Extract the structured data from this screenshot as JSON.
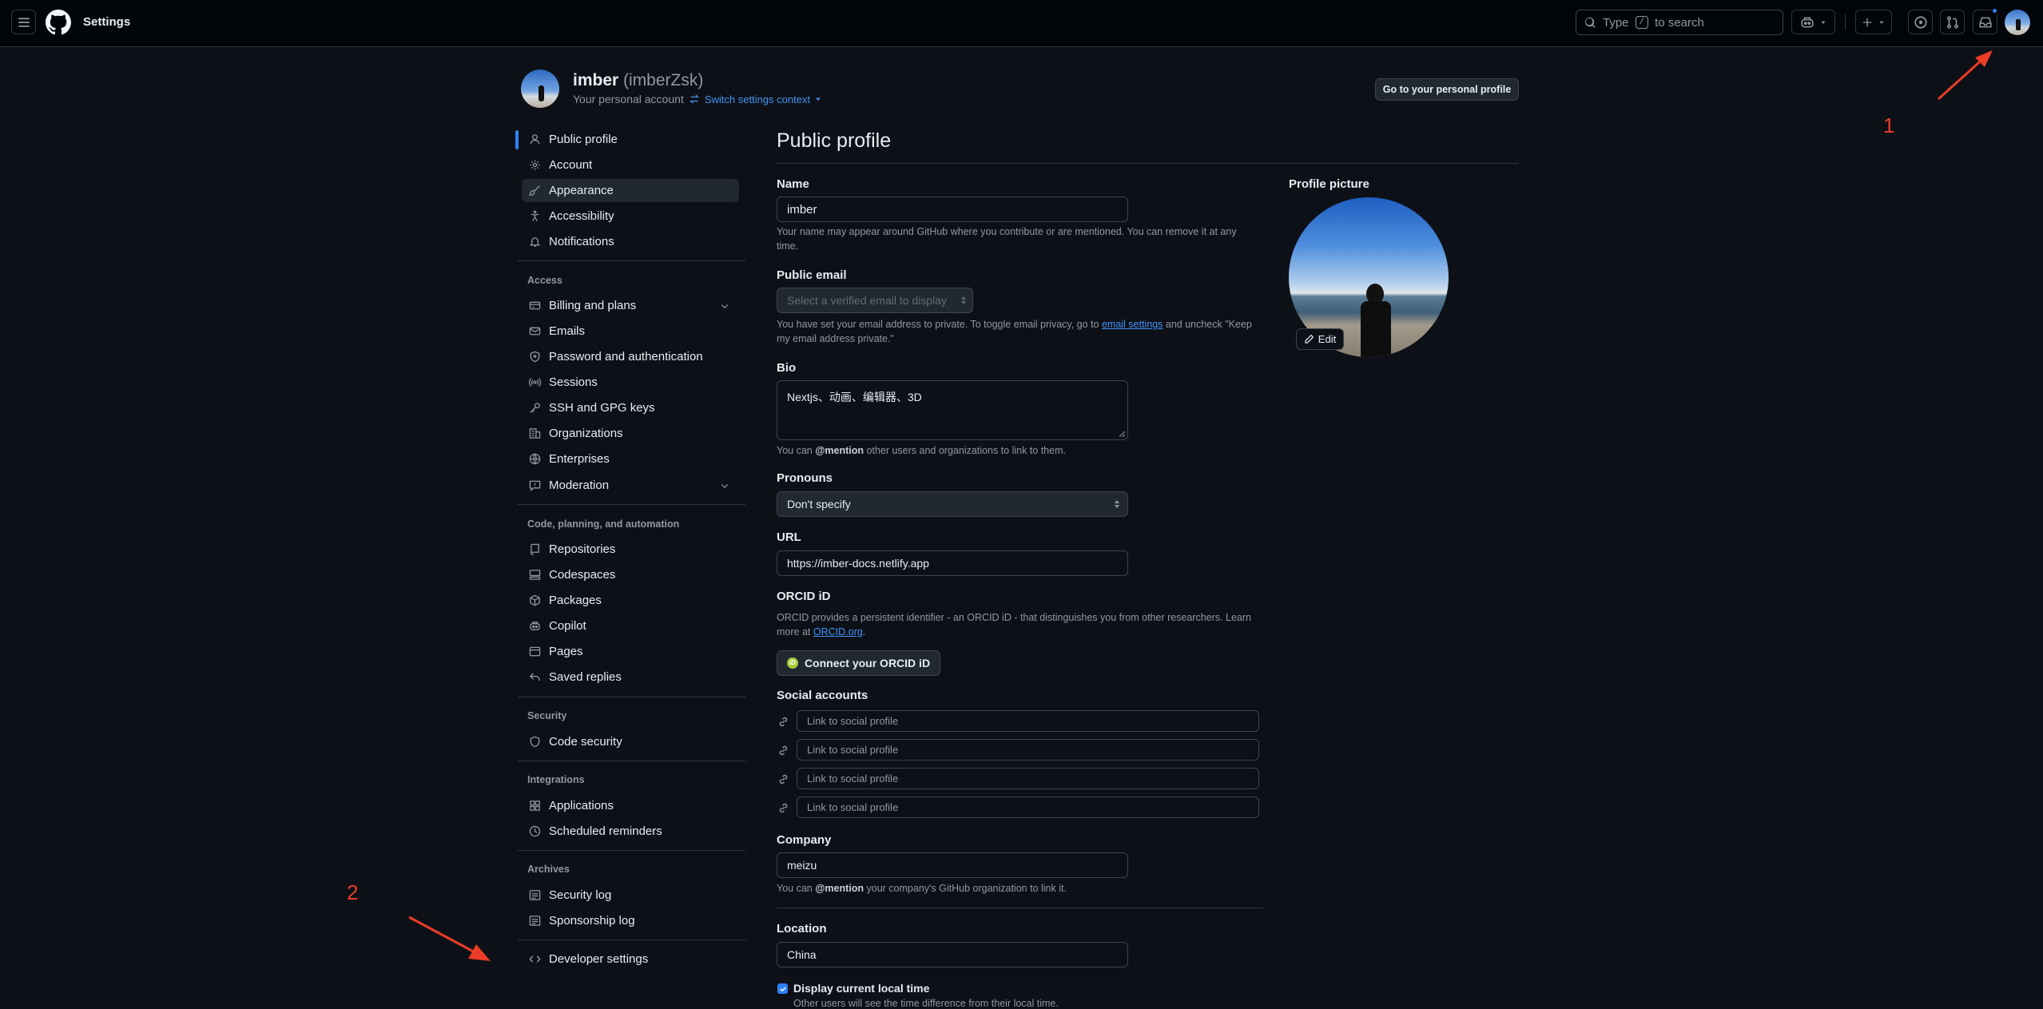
{
  "header": {
    "title": "Settings",
    "search_prefix": "Type",
    "search_key": "/",
    "search_suffix": "to search"
  },
  "account": {
    "name": "imber",
    "login": "(imberZsk)",
    "subtitle": "Your personal account",
    "switch_context": "Switch settings context",
    "go_profile": "Go to your personal profile"
  },
  "sidebar": {
    "top": [
      "Public profile",
      "Account",
      "Appearance",
      "Accessibility",
      "Notifications"
    ],
    "access_head": "Access",
    "access": [
      "Billing and plans",
      "Emails",
      "Password and authentication",
      "Sessions",
      "SSH and GPG keys",
      "Organizations",
      "Enterprises",
      "Moderation"
    ],
    "code_head": "Code, planning, and automation",
    "code": [
      "Repositories",
      "Codespaces",
      "Packages",
      "Copilot",
      "Pages",
      "Saved replies"
    ],
    "security_head": "Security",
    "security": [
      "Code security"
    ],
    "integrations_head": "Integrations",
    "integrations": [
      "Applications",
      "Scheduled reminders"
    ],
    "archives_head": "Archives",
    "archives": [
      "Security log",
      "Sponsorship log"
    ],
    "developer": "Developer settings"
  },
  "form": {
    "page_title": "Public profile",
    "name_label": "Name",
    "name_value": "imber",
    "name_note": "Your name may appear around GitHub where you contribute or are mentioned. You can remove it at any",
    "name_note2": "time.",
    "email_label": "Public email",
    "email_placeholder": "Select a verified email to display",
    "email_note_a": "You have set your email address to private. To toggle email privacy, go to",
    "email_note_link": "email settings",
    "email_note_b": "and uncheck \"Keep",
    "email_note2": "my email address private.\"",
    "bio_label": "Bio",
    "bio_value": "Nextjs、动画、编辑器、3D",
    "bio_note_a": "You can",
    "bio_note_mention": "@mention",
    "bio_note_b": "other users and organizations to link to them.",
    "pronouns_label": "Pronouns",
    "pronouns_value": "Don't specify",
    "url_label": "URL",
    "url_value": "https://imber-docs.netlify.app",
    "orcid_label": "ORCID iD",
    "orcid_note": "ORCID provides a persistent identifier - an ORCID iD - that distinguishes you from other researchers. Learn",
    "orcid_note2a": "more at",
    "orcid_note2_link": "ORCID.org",
    "orcid_button": "Connect your ORCID iD",
    "social_label": "Social accounts",
    "social_placeholder": "Link to social profile",
    "company_label": "Company",
    "company_value": "meizu",
    "company_note_a": "You can",
    "company_note_mention": "@mention",
    "company_note_b": "your company's GitHub organization to link it.",
    "location_label": "Location",
    "location_value": "China",
    "localtime_label": "Display current local time",
    "localtime_note": "Other users will see the time difference from their local time.",
    "picture_label": "Profile picture",
    "edit_button": "Edit"
  },
  "annotations": {
    "one": "1",
    "two": "2"
  },
  "colors": {
    "accent": "#2f81f7",
    "annotation": "#ea3c26",
    "background": "#0d1117"
  }
}
